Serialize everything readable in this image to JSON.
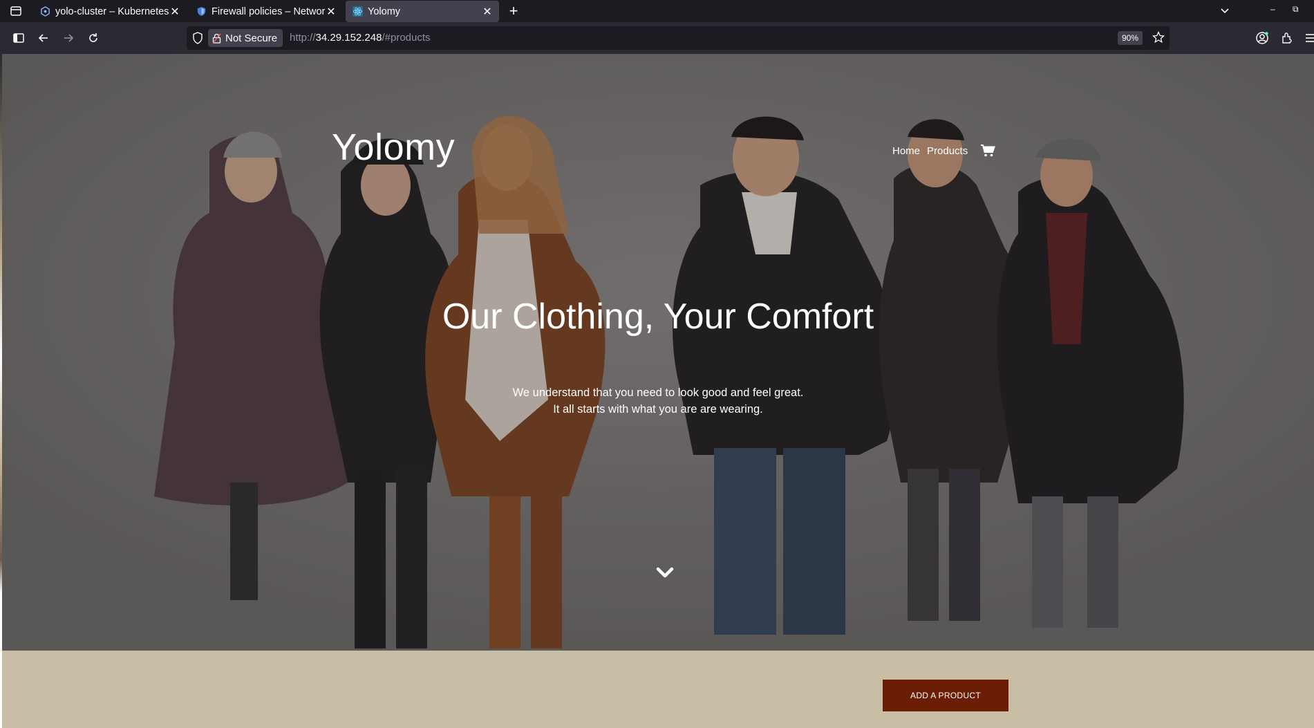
{
  "browser": {
    "tabs": [
      {
        "title": "yolo-cluster – Kubernetes",
        "icon": "kubernetes-engine-icon"
      },
      {
        "title": "Firewall policies – Networ",
        "icon": "shield-icon"
      },
      {
        "title": "Yolomy",
        "icon": "react-icon",
        "active": true
      }
    ],
    "security_label": "Not Secure",
    "url_prefix": "http://",
    "url_host": "34.29.152.248",
    "url_path": "/#products",
    "zoom": "90%"
  },
  "site": {
    "brand": "Yolomy",
    "nav": {
      "home": "Home",
      "products": "Products"
    },
    "hero_title": "Our Clothing, Your Comfort",
    "hero_line1": "We understand that you need to look good and feel great.",
    "hero_line2": "It all starts with what you are are wearing.",
    "add_button": "ADD A PRODUCT"
  },
  "colors": {
    "band": "#c7bea5",
    "button": "#6b1d05",
    "chrome_dark": "#1c1b22",
    "chrome_toolbar": "#2b2a33"
  }
}
